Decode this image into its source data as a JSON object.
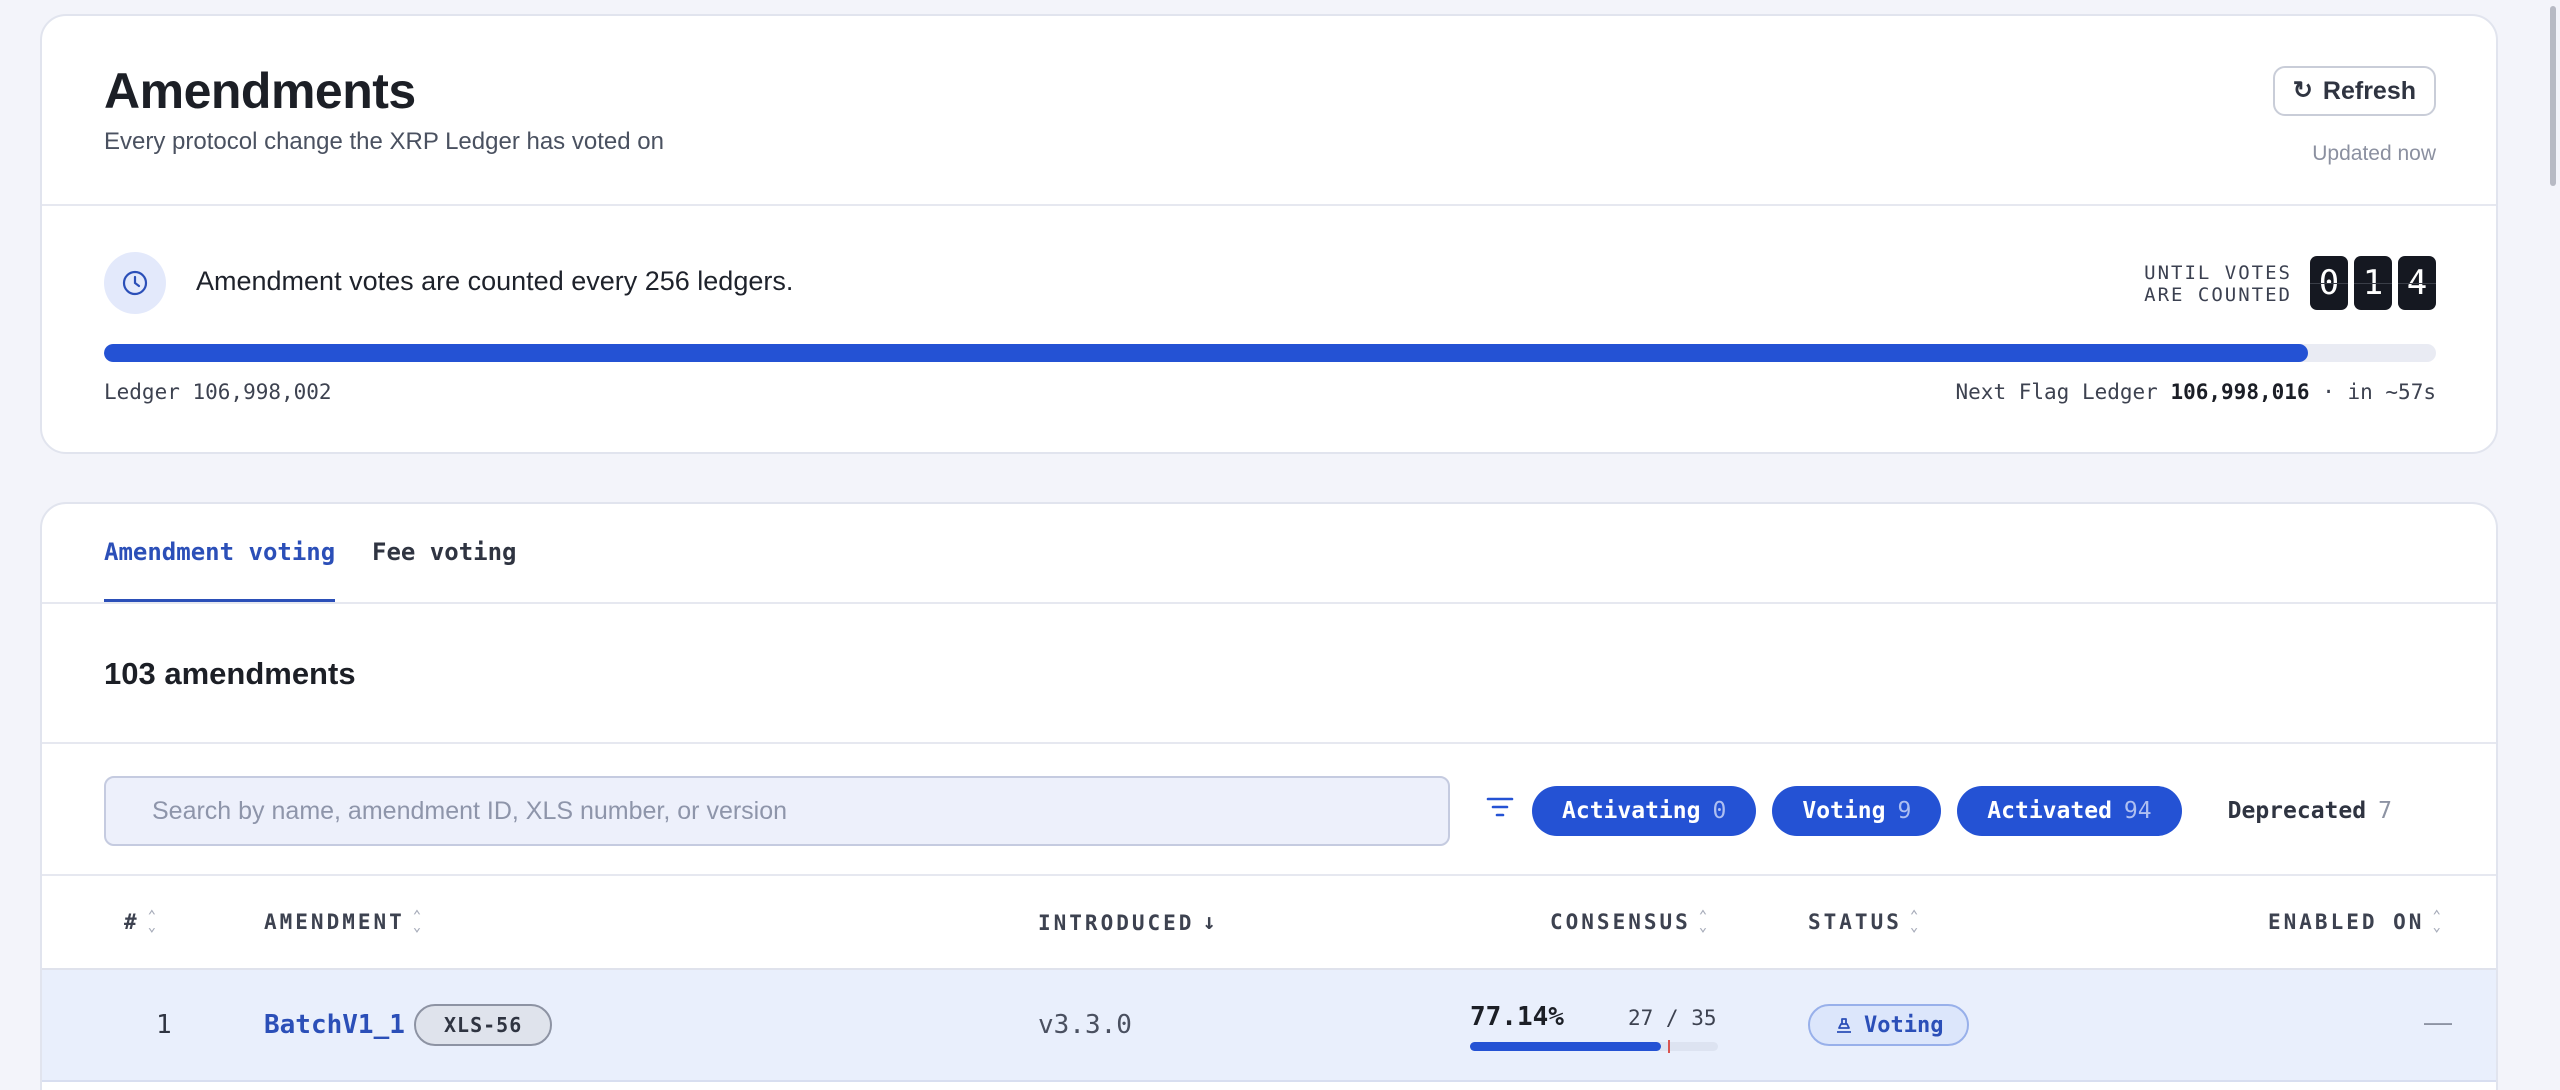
{
  "header": {
    "title": "Amendments",
    "subtitle": "Every protocol change the XRP Ledger has voted on",
    "refresh_label": "Refresh",
    "updated": "Updated now"
  },
  "voting_info": {
    "message": "Amendment votes are counted every 256 ledgers.",
    "until_line1": "UNTIL VOTES",
    "until_line2": "ARE COUNTED",
    "countdown": [
      "0",
      "1",
      "4"
    ],
    "progress_fraction": 0.945,
    "ledger_label": "Ledger 106,998,002",
    "next_flag_prefix": "Next Flag Ledger",
    "next_flag_value": "106,998,016",
    "next_flag_suffix": "· in ~57s"
  },
  "tabs": [
    {
      "label": "Amendment voting",
      "active": true
    },
    {
      "label": "Fee voting",
      "active": false
    }
  ],
  "amendments_count": "103 amendments",
  "search": {
    "placeholder": "Search by name, amendment ID, XLS number, or version"
  },
  "filters": [
    {
      "label": "Activating",
      "count": "0",
      "active": true
    },
    {
      "label": "Voting",
      "count": "9",
      "active": true
    },
    {
      "label": "Activated",
      "count": "94",
      "active": true
    },
    {
      "label": "Deprecated",
      "count": "7",
      "active": false
    }
  ],
  "table": {
    "columns": [
      "#",
      "AMENDMENT",
      "INTRODUCED",
      "CONSENSUS",
      "STATUS",
      "ENABLED ON"
    ],
    "rows": [
      {
        "num": "1",
        "name": "BatchV1_1",
        "xls": "XLS-56",
        "introduced": "v3.3.0",
        "consensus_pct": "77.14%",
        "consensus_ratio": "27 / 35",
        "consensus_fraction": 0.7714,
        "threshold_fraction": 0.8,
        "status": "Voting",
        "enabled_on": "—"
      }
    ]
  },
  "colors": {
    "accent": "#2452d4",
    "link": "#2b4fb8",
    "threshold": "#d9534f"
  }
}
